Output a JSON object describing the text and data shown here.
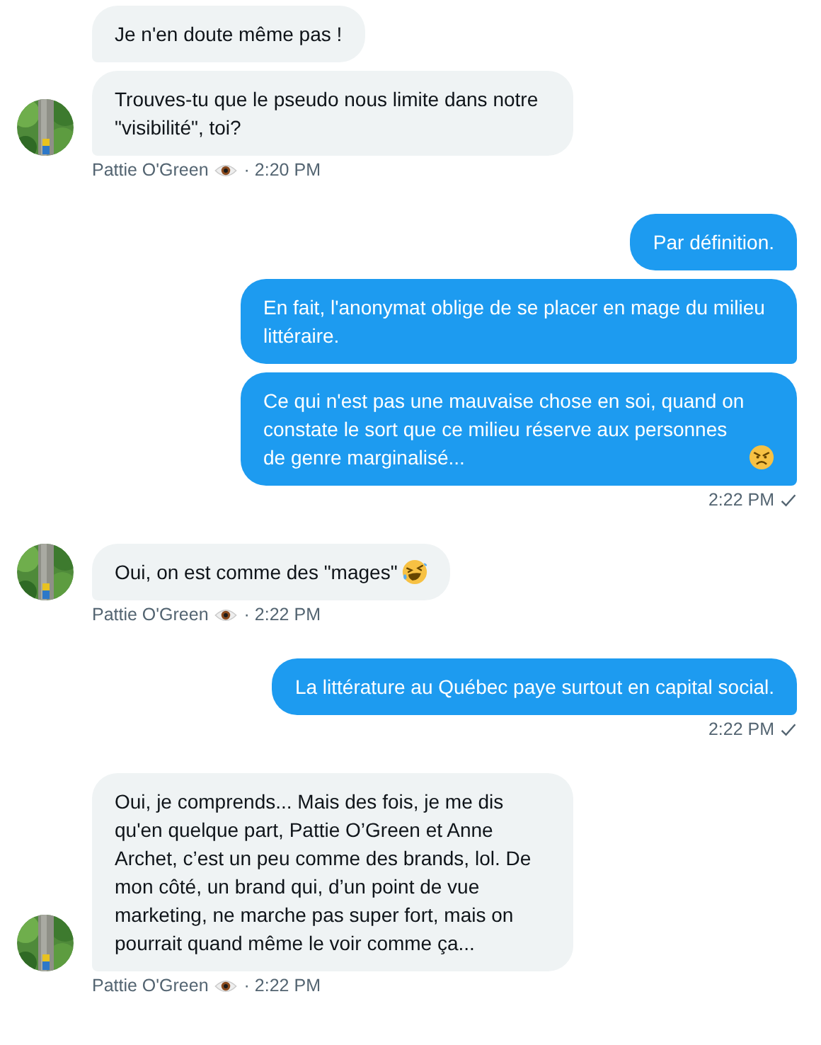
{
  "groups": [
    {
      "kind": "incoming",
      "messages": [
        {
          "kind": "plain",
          "text": "Je n'en doute même pas !"
        },
        {
          "kind": "plain",
          "text": "Trouves-tu que le pseudo nous limite dans notre \"visibilité\", toi?"
        }
      ],
      "sender": "Pattie O'Green",
      "time": "· 2:20 PM"
    },
    {
      "kind": "outgoing",
      "messages": [
        {
          "kind": "plain",
          "text": "Par définition."
        },
        {
          "kind": "plain",
          "text": "En fait, l'anonymat oblige de se placer en mage du milieu littéraire."
        },
        {
          "kind": "angry_emoji",
          "text": "Ce qui n'est pas une mauvaise chose en soi, quand on constate le sort que ce milieu réserve aux personnes de genre marginalisé..."
        }
      ],
      "time": "2:22 PM",
      "read": true
    },
    {
      "kind": "incoming",
      "messages": [
        {
          "kind": "laughing_emoji",
          "text": "Oui, on est comme des \"mages\""
        }
      ],
      "sender": "Pattie O'Green",
      "time": "· 2:22 PM"
    },
    {
      "kind": "outgoing",
      "messages": [
        {
          "kind": "plain",
          "text": "La littérature au Québec paye surtout en capital social."
        }
      ],
      "time": "2:22 PM",
      "read": true
    },
    {
      "kind": "incoming",
      "messages": [
        {
          "kind": "plain",
          "text": "Oui, je comprends... Mais des fois, je me dis qu'en quelque part, Pattie O’Green et Anne Archet, c’est un peu comme des brands, lol. De mon côté, un brand qui, d’un point de vue marketing, ne marche pas super fort, mais on pourrait quand même le voir comme ça..."
        }
      ],
      "sender": "Pattie O'Green",
      "time": "· 2:22 PM"
    }
  ]
}
